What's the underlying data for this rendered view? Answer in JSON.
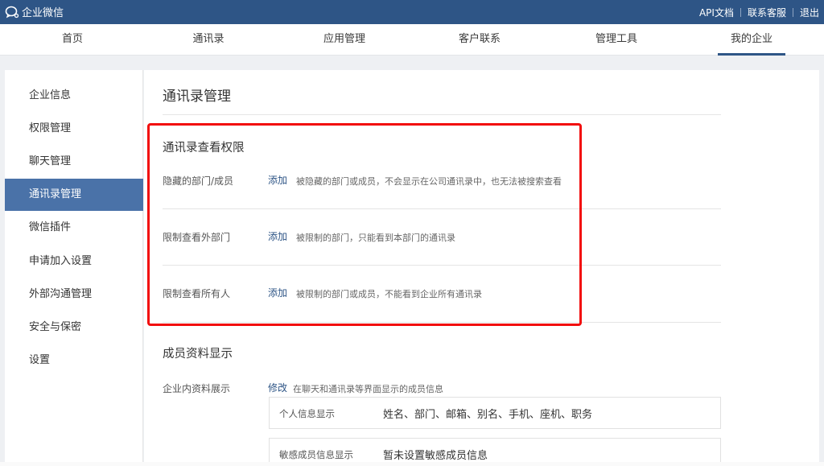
{
  "app": {
    "logo_text": "企业微信"
  },
  "top_links": [
    "API文档",
    "联系客服",
    "退出"
  ],
  "nav": {
    "items": [
      "首页",
      "通讯录",
      "应用管理",
      "客户联系",
      "管理工具",
      "我的企业"
    ],
    "active": "我的企业"
  },
  "sidebar": {
    "items": [
      "企业信息",
      "权限管理",
      "聊天管理",
      "通讯录管理",
      "微信插件",
      "申请加入设置",
      "外部沟通管理",
      "安全与保密",
      "设置"
    ],
    "active": "通讯录管理"
  },
  "main": {
    "title": "通讯录管理",
    "view_perm": {
      "title": "通讯录查看权限",
      "rows": [
        {
          "label": "隐藏的部门/成员",
          "action": "添加",
          "desc": "被隐藏的部门或成员，不会显示在公司通讯录中，也无法被搜索查看"
        },
        {
          "label": "限制查看外部门",
          "action": "添加",
          "desc": "被限制的部门，只能看到本部门的通讯录"
        },
        {
          "label": "限制查看所有人",
          "action": "添加",
          "desc": "被限制的部门或成员，不能看到企业所有通讯录"
        }
      ]
    },
    "member_display": {
      "title": "成员资料显示",
      "label": "企业内资料展示",
      "action": "修改",
      "desc": "在聊天和通讯录等界面显示的成员信息",
      "box": [
        {
          "label": "个人信息显示",
          "value": "姓名、部门、邮箱、别名、手机、座机、职务"
        },
        {
          "label": "敏感成员信息显示",
          "value": "暂未设置敏感成员信息"
        }
      ]
    }
  },
  "colors": {
    "topbar": "#2e5586",
    "accent": "#4a72a8",
    "highlight": "#f20d0d",
    "link": "#2e5586"
  }
}
